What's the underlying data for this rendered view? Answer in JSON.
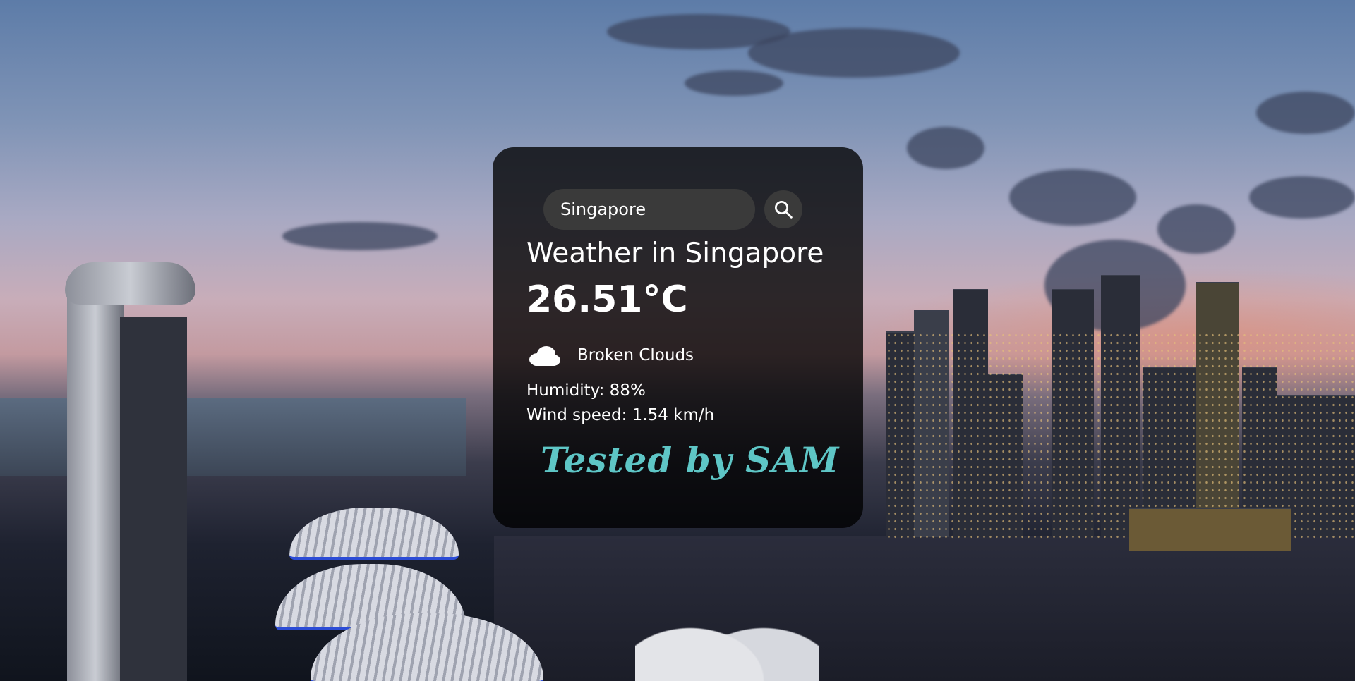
{
  "search": {
    "value": "Singapore",
    "button_icon": "search-icon"
  },
  "weather": {
    "title": "Weather in Singapore",
    "temperature": "26.51°C",
    "condition_icon": "cloud-icon",
    "description": "Broken Clouds",
    "humidity": "Humidity: 88%",
    "wind": "Wind speed: 1.54 km/h"
  },
  "footer": {
    "tested_by": "Tested by SAM"
  },
  "colors": {
    "card_background": "#000000",
    "input_background": "#3a3a3a",
    "accent_text": "#5ec6c6"
  }
}
